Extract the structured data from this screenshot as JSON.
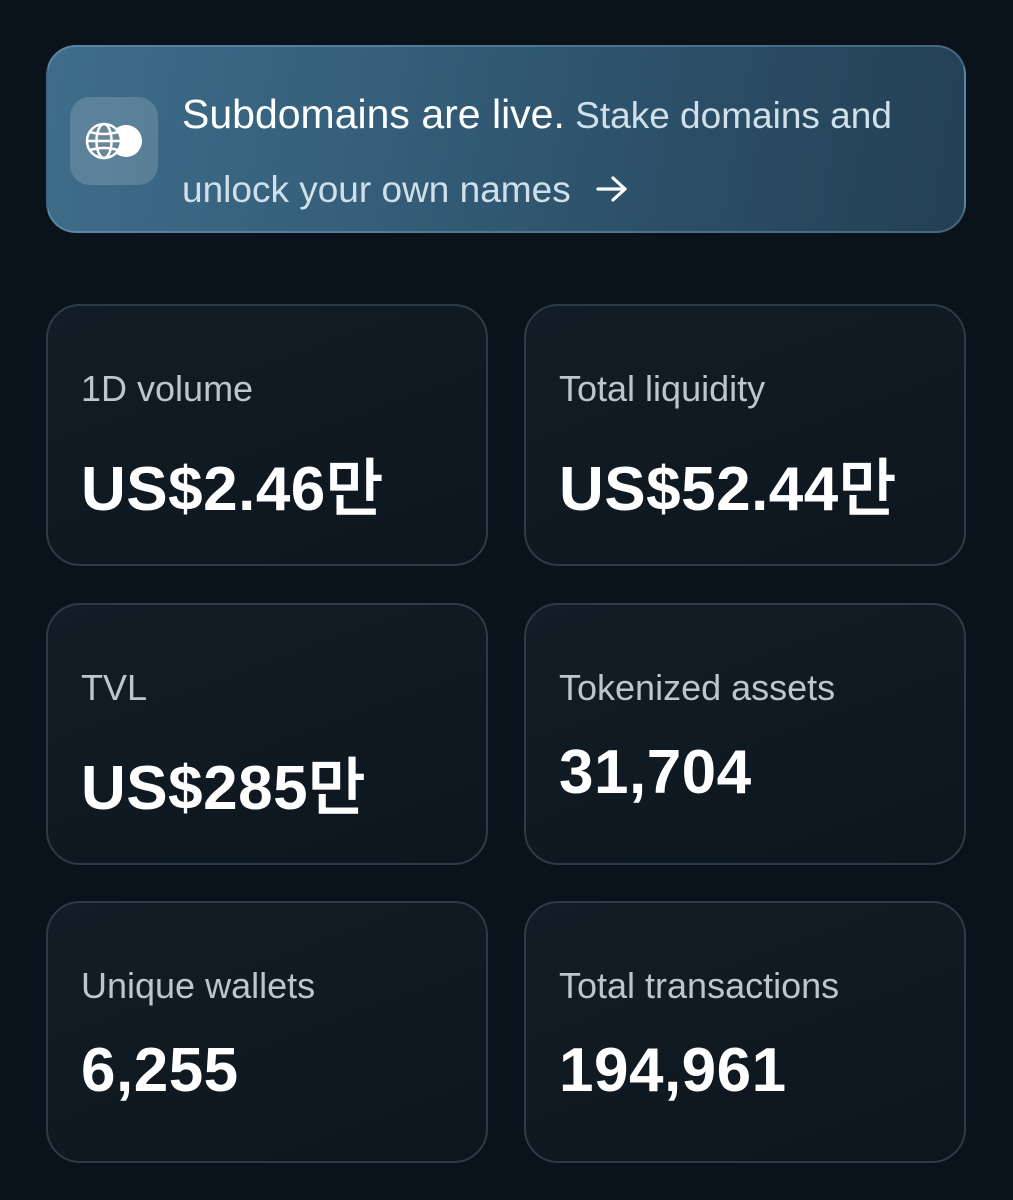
{
  "banner": {
    "title": "Subdomains are live.",
    "body": "Stake domains and unlock your own names",
    "icon": "globe-coins-icon",
    "arrow_icon": "arrow-right-icon"
  },
  "stats": [
    {
      "label": "1D volume",
      "value": "US$2.46만"
    },
    {
      "label": "Total liquidity",
      "value": "US$52.44만"
    },
    {
      "label": "TVL",
      "value": "US$285만"
    },
    {
      "label": "Tokenized assets",
      "value": "31,704"
    },
    {
      "label": "Unique wallets",
      "value": "6,255"
    },
    {
      "label": "Total transactions",
      "value": "194,961"
    }
  ],
  "colors": {
    "background": "#0a131b",
    "banner_start": "#3e6d8a",
    "banner_end": "#233f54",
    "card_border": "#2f3b44",
    "label": "#bcc6cd",
    "value": "#ffffff"
  }
}
